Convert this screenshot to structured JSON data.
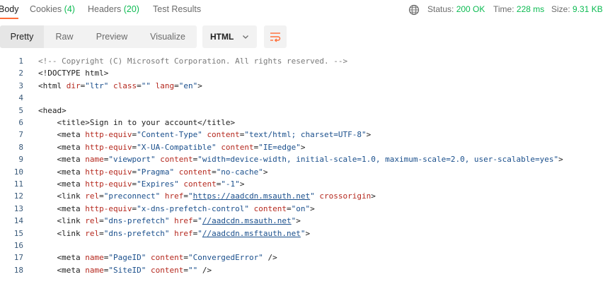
{
  "tabs": [
    {
      "label": "Body",
      "count": ""
    },
    {
      "label": "Cookies",
      "count": "(4)"
    },
    {
      "label": "Headers",
      "count": "(20)"
    },
    {
      "label": "Test Results",
      "count": ""
    }
  ],
  "status": {
    "status_label": "Status:",
    "status_value": "200 OK",
    "time_label": "Time:",
    "time_value": "228 ms",
    "size_label": "Size:",
    "size_value": "9.31 KB"
  },
  "toolbar": {
    "views": [
      "Pretty",
      "Raw",
      "Preview",
      "Visualize"
    ],
    "language": "HTML"
  },
  "code_lines": [
    {
      "n": "1",
      "tokens": [
        [
          "c",
          "<!-- Copyright (C) Microsoft Corporation. All rights reserved. -->"
        ]
      ]
    },
    {
      "n": "2",
      "tokens": [
        [
          "t",
          "<!DOCTYPE html>"
        ]
      ]
    },
    {
      "n": "3",
      "tokens": [
        [
          "t",
          "<html "
        ],
        [
          "a",
          "dir"
        ],
        [
          "t",
          "="
        ],
        [
          "s",
          "\"ltr\""
        ],
        [
          "t",
          " "
        ],
        [
          "a",
          "class"
        ],
        [
          "t",
          "="
        ],
        [
          "s",
          "\"\""
        ],
        [
          "t",
          " "
        ],
        [
          "a",
          "lang"
        ],
        [
          "t",
          "="
        ],
        [
          "s",
          "\"en\""
        ],
        [
          "t",
          ">"
        ]
      ]
    },
    {
      "n": "4",
      "tokens": []
    },
    {
      "n": "5",
      "tokens": [
        [
          "t",
          "<head>"
        ]
      ]
    },
    {
      "n": "6",
      "tokens": [
        [
          "t",
          "    <title>Sign in to your account</title>"
        ]
      ]
    },
    {
      "n": "7",
      "tokens": [
        [
          "t",
          "    <meta "
        ],
        [
          "a",
          "http-equiv"
        ],
        [
          "t",
          "="
        ],
        [
          "s",
          "\"Content-Type\""
        ],
        [
          "t",
          " "
        ],
        [
          "a",
          "content"
        ],
        [
          "t",
          "="
        ],
        [
          "s",
          "\"text/html; charset=UTF-8\""
        ],
        [
          "t",
          ">"
        ]
      ]
    },
    {
      "n": "8",
      "tokens": [
        [
          "t",
          "    <meta "
        ],
        [
          "a",
          "http-equiv"
        ],
        [
          "t",
          "="
        ],
        [
          "s",
          "\"X-UA-Compatible\""
        ],
        [
          "t",
          " "
        ],
        [
          "a",
          "content"
        ],
        [
          "t",
          "="
        ],
        [
          "s",
          "\"IE=edge\""
        ],
        [
          "t",
          ">"
        ]
      ]
    },
    {
      "n": "9",
      "tokens": [
        [
          "t",
          "    <meta "
        ],
        [
          "a",
          "name"
        ],
        [
          "t",
          "="
        ],
        [
          "s",
          "\"viewport\""
        ],
        [
          "t",
          " "
        ],
        [
          "a",
          "content"
        ],
        [
          "t",
          "="
        ],
        [
          "s",
          "\"width=device-width, initial-scale=1.0, maximum-scale=2.0, user-scalable=yes\""
        ],
        [
          "t",
          ">"
        ]
      ]
    },
    {
      "n": "10",
      "tokens": [
        [
          "t",
          "    <meta "
        ],
        [
          "a",
          "http-equiv"
        ],
        [
          "t",
          "="
        ],
        [
          "s",
          "\"Pragma\""
        ],
        [
          "t",
          " "
        ],
        [
          "a",
          "content"
        ],
        [
          "t",
          "="
        ],
        [
          "s",
          "\"no-cache\""
        ],
        [
          "t",
          ">"
        ]
      ]
    },
    {
      "n": "11",
      "tokens": [
        [
          "t",
          "    <meta "
        ],
        [
          "a",
          "http-equiv"
        ],
        [
          "t",
          "="
        ],
        [
          "s",
          "\"Expires\""
        ],
        [
          "t",
          " "
        ],
        [
          "a",
          "content"
        ],
        [
          "t",
          "="
        ],
        [
          "s",
          "\"-1\""
        ],
        [
          "t",
          ">"
        ]
      ]
    },
    {
      "n": "12",
      "tokens": [
        [
          "t",
          "    <link "
        ],
        [
          "a",
          "rel"
        ],
        [
          "t",
          "="
        ],
        [
          "s",
          "\"preconnect\""
        ],
        [
          "t",
          " "
        ],
        [
          "a",
          "href"
        ],
        [
          "t",
          "="
        ],
        [
          "s",
          "\""
        ],
        [
          "l",
          "https://aadcdn.msauth.net"
        ],
        [
          "s",
          "\""
        ],
        [
          "t",
          " "
        ],
        [
          "a",
          "crossorigin"
        ],
        [
          "t",
          ">"
        ]
      ]
    },
    {
      "n": "13",
      "tokens": [
        [
          "t",
          "    <meta "
        ],
        [
          "a",
          "http-equiv"
        ],
        [
          "t",
          "="
        ],
        [
          "s",
          "\"x-dns-prefetch-control\""
        ],
        [
          "t",
          " "
        ],
        [
          "a",
          "content"
        ],
        [
          "t",
          "="
        ],
        [
          "s",
          "\"on\""
        ],
        [
          "t",
          ">"
        ]
      ]
    },
    {
      "n": "14",
      "tokens": [
        [
          "t",
          "    <link "
        ],
        [
          "a",
          "rel"
        ],
        [
          "t",
          "="
        ],
        [
          "s",
          "\"dns-prefetch\""
        ],
        [
          "t",
          " "
        ],
        [
          "a",
          "href"
        ],
        [
          "t",
          "="
        ],
        [
          "s",
          "\""
        ],
        [
          "l",
          "//aadcdn.msauth.net"
        ],
        [
          "s",
          "\""
        ],
        [
          "t",
          ">"
        ]
      ]
    },
    {
      "n": "15",
      "tokens": [
        [
          "t",
          "    <link "
        ],
        [
          "a",
          "rel"
        ],
        [
          "t",
          "="
        ],
        [
          "s",
          "\"dns-prefetch\""
        ],
        [
          "t",
          " "
        ],
        [
          "a",
          "href"
        ],
        [
          "t",
          "="
        ],
        [
          "s",
          "\""
        ],
        [
          "l",
          "//aadcdn.msftauth.net"
        ],
        [
          "s",
          "\""
        ],
        [
          "t",
          ">"
        ]
      ]
    },
    {
      "n": "16",
      "tokens": []
    },
    {
      "n": "17",
      "tokens": [
        [
          "t",
          "    <meta "
        ],
        [
          "a",
          "name"
        ],
        [
          "t",
          "="
        ],
        [
          "s",
          "\"PageID\""
        ],
        [
          "t",
          " "
        ],
        [
          "a",
          "content"
        ],
        [
          "t",
          "="
        ],
        [
          "s",
          "\"ConvergedError\""
        ],
        [
          "t",
          " />"
        ]
      ]
    },
    {
      "n": "18",
      "tokens": [
        [
          "t",
          "    <meta "
        ],
        [
          "a",
          "name"
        ],
        [
          "t",
          "="
        ],
        [
          "s",
          "\"SiteID\""
        ],
        [
          "t",
          " "
        ],
        [
          "a",
          "content"
        ],
        [
          "t",
          "="
        ],
        [
          "s",
          "\"\""
        ],
        [
          "t",
          " />"
        ]
      ]
    }
  ]
}
